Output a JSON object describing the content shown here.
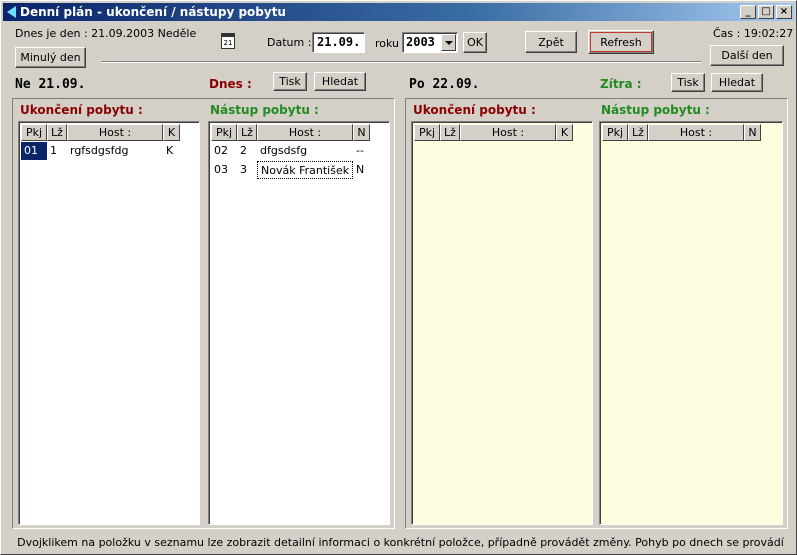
{
  "window": {
    "title": "Denní plán -  ukončení / nástupy pobytu",
    "min_glyph": "_",
    "max_glyph": "□",
    "close_glyph": "×"
  },
  "toolbar": {
    "today_text": "Dnes je den : 21.09.2003  Neděle",
    "prev_day_label": "Minulý den",
    "next_day_label": "Další den",
    "date_label": "Datum :",
    "date_value": "21.09.",
    "year_label": "roku",
    "year_value": "2003",
    "ok_label": "OK",
    "back_label": "Zpět",
    "refresh_label": "Refresh",
    "time_text": "Čas : 19:02:27",
    "calendar_icon_text": "21"
  },
  "today": {
    "day_label": "Ne  21.09.",
    "section_label": "Dnes :",
    "print_label": "Tisk",
    "search_label": "Hledat",
    "departures": {
      "title": "Ukončení pobytu :",
      "columns": [
        "Pkj",
        "Lž",
        "Host :",
        "K"
      ],
      "rows": [
        {
          "pkj": "01",
          "lz": "1",
          "host": "rgfsdgsfdg",
          "flag": "K"
        }
      ]
    },
    "arrivals": {
      "title": "Nástup pobytu :",
      "columns": [
        "Pkj",
        "Lž",
        "Host :",
        "N"
      ],
      "rows": [
        {
          "pkj": "02",
          "lz": "2",
          "host": "dfgsdsfg",
          "flag": "--"
        },
        {
          "pkj": "03",
          "lz": "3",
          "host": "Novák František",
          "flag": "N"
        }
      ]
    }
  },
  "tomorrow": {
    "day_label": "Po  22.09.",
    "section_label": "Zítra :",
    "print_label": "Tisk",
    "search_label": "Hledat",
    "departures": {
      "title": "Ukončení pobytu :",
      "columns": [
        "Pkj",
        "Lž",
        "Host :",
        "K"
      ]
    },
    "arrivals": {
      "title": "Nástup pobytu :",
      "columns": [
        "Pkj",
        "Lž",
        "Host :",
        "N"
      ]
    }
  },
  "status": {
    "hint": "Dvojklikem na položku v seznamu lze zobrazit detailní informaci o konkrétní položce, případně provádět změny. Pohyb po dnech se provádí \"Minulý\" / \"Další\"."
  }
}
